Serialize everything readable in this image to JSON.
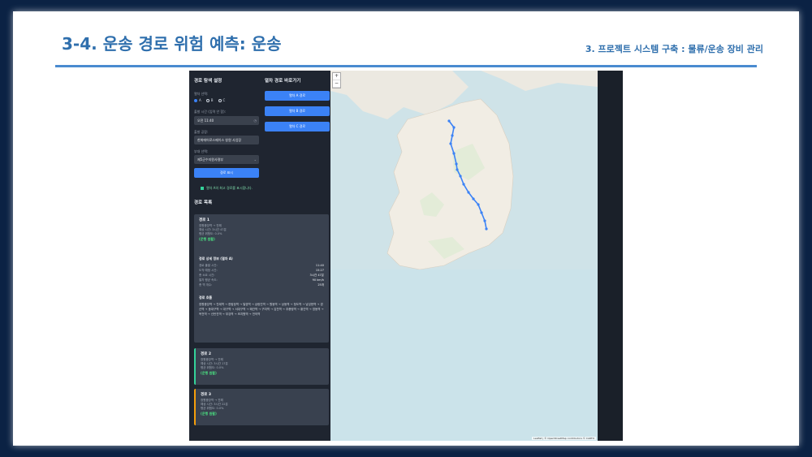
{
  "slide": {
    "title": "3-4. 운송 경로 위험 예측: 운송",
    "subtitle": "3. 프로젝트 시스템 구축 : 물류/운송 장비 관리"
  },
  "left_panel": {
    "heading": "경로 탐색 설정",
    "train_label": "열차 선택:",
    "radios": [
      "A",
      "B",
      "C"
    ],
    "time_label": "출발 시간 (입력 안 함):",
    "time_value": "오전 11:40",
    "origin_label": "출발 공장:",
    "origin_value": "한화에어로스페이스 창원 사업장",
    "unit_label": "부대 선택:",
    "unit_value": "제5군수지원사령부",
    "search_button": "경로 표시",
    "notice": "열차 A의 최고 경로를 표시합니다.",
    "list_heading": "경로 목록"
  },
  "quick_panel": {
    "heading": "열차 경로 바로가기",
    "buttons": [
      "열차 A 경로",
      "열차 B 경로",
      "열차 C 경로"
    ]
  },
  "routes": [
    {
      "title": "경로 1",
      "lines": [
        "창원중앙역 → 진해",
        "예상 시간: 3시간 47분",
        "평균 위험도: 0.0%"
      ],
      "status": "(운행 원활)",
      "detail_heading": "경로 상세 정보 (열차 A)",
      "details": [
        {
          "k": "경로 출발 시간:",
          "v": "11:40"
        },
        {
          "k": "도착 예정 시간:",
          "v": "15:27"
        },
        {
          "k": "총 소요 시간:",
          "v": "3시간 47분"
        },
        {
          "k": "열차 평균 속도:",
          "v": "90 km/h"
        },
        {
          "k": "총 역 개수:",
          "v": "25개"
        }
      ],
      "stations_heading": "경로 흐름",
      "stations": "창원중앙역 → 진례역 → 한림정역 → 밀양역 → 삼랑진역 → 원동역 → 상동역 → 청도역 → 남성현역 → 경산역 → 동대구역 → 대구역 → 서대구역 → 왜관역 → 구미역 → 김천역 → 추풍령역 → 황간역 → 영동역 → 옥천역 → 신탄진역 → 부강역 → 조치원역 → 전의역"
    },
    {
      "title": "경로 2",
      "lines": [
        "창원중앙역 → 진해",
        "예상 시간: 3시간 17분",
        "평균 위험도: 0.0%"
      ],
      "status": "(운행 원활)"
    },
    {
      "title": "경로 3",
      "lines": [
        "창원중앙역 → 진해",
        "예상 시간: 3시간 22분",
        "평균 위험도: 0.0%"
      ],
      "status": "(운행 원활)"
    }
  ],
  "map": {
    "zoom_in": "+",
    "zoom_out": "−",
    "attribution": "Leaflet | © OpenStreetMap contributors © CARTO"
  },
  "colors": {
    "accent": "#3b82f6",
    "status_ok": "#4ade80",
    "route_line": "#3b82f6"
  }
}
